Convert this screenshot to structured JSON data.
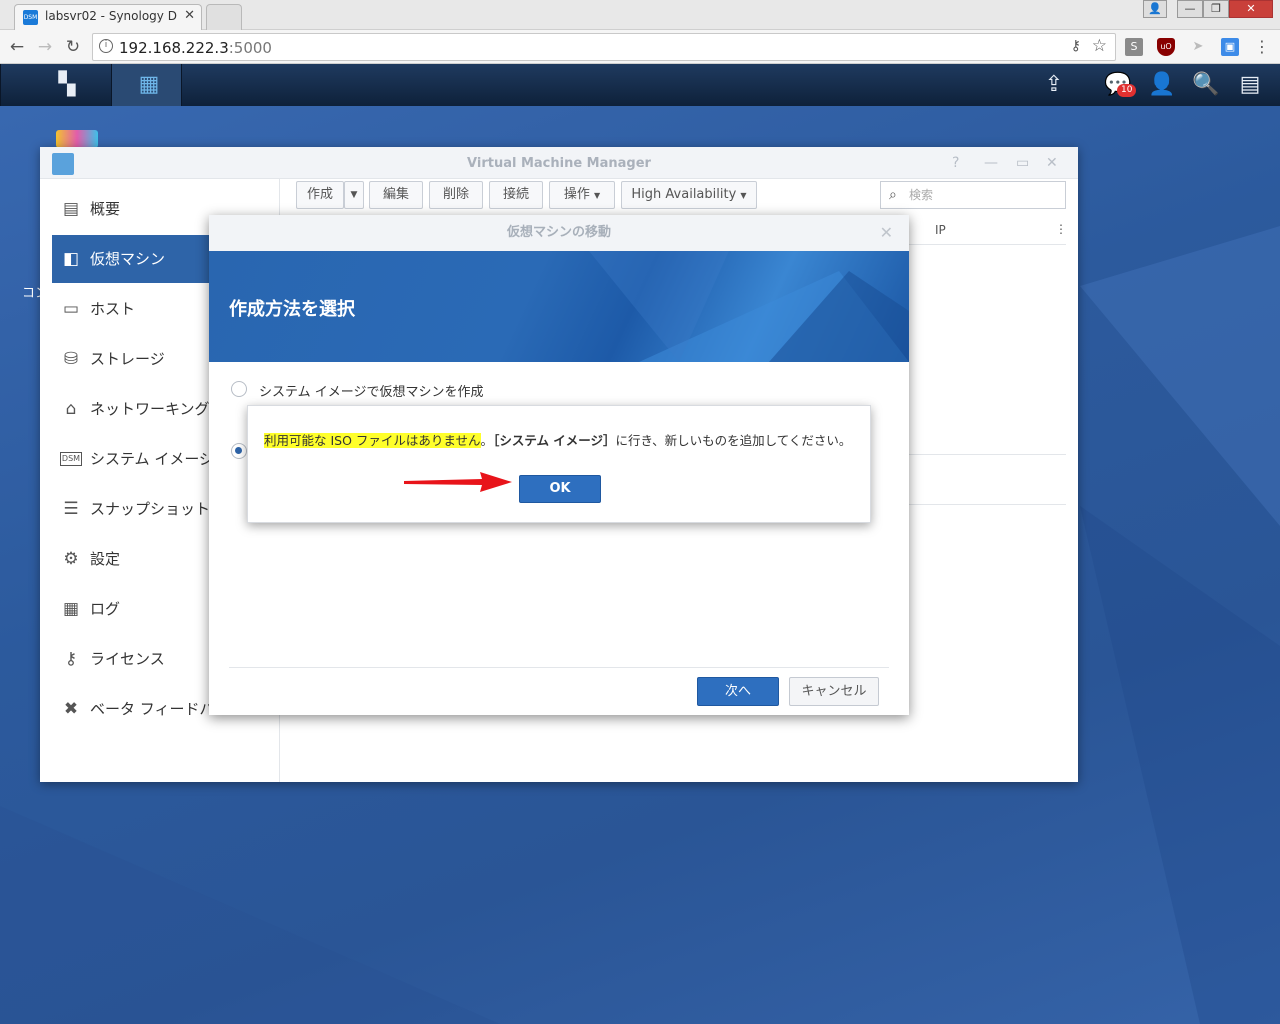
{
  "browser": {
    "tab_title": "labsvr02 - Synology D",
    "favicon_text": "DSM",
    "url_host": "192.168.222.3",
    "url_port": ":5000"
  },
  "window_title": "Virtual Machine Manager",
  "notification_count": "10",
  "desktop_partial_label": "コン",
  "sidebar": [
    {
      "label": "概要",
      "icon": "overview-icon"
    },
    {
      "label": "仮想マシン",
      "icon": "vm-icon"
    },
    {
      "label": "ホスト",
      "icon": "host-icon"
    },
    {
      "label": "ストレージ",
      "icon": "storage-icon"
    },
    {
      "label": "ネットワーキング",
      "icon": "network-icon"
    },
    {
      "label": "システム イメージ",
      "icon": "dsm-icon"
    },
    {
      "label": "スナップショット",
      "icon": "snapshot-icon"
    },
    {
      "label": "設定",
      "icon": "gear-icon"
    },
    {
      "label": "ログ",
      "icon": "log-icon"
    },
    {
      "label": "ライセンス",
      "icon": "key-icon"
    },
    {
      "label": "ベータ フィードバ",
      "icon": "tools-icon"
    }
  ],
  "toolbar": {
    "create": "作成",
    "edit": "編集",
    "delete": "削除",
    "connect": "接続",
    "action": "操作",
    "ha": "High Availability",
    "search_placeholder": "検索"
  },
  "table": {
    "col_ip": "IP"
  },
  "wizard": {
    "title": "仮想マシンの移動",
    "heading": "作成方法を選択",
    "option1": "システム イメージで仮想マシンを作成",
    "next": "次へ",
    "cancel": "キャンセル"
  },
  "alert": {
    "highlight": "利用可能な ISO ファイルはありません",
    "sep": "。",
    "bold": "［システム イメージ］",
    "rest": "に行き、新しいものを追加してください。",
    "ok": "OK"
  },
  "colors": {
    "accent": "#2e64a8",
    "arrow": "#e8141a",
    "highlight": "#ffff2b"
  }
}
